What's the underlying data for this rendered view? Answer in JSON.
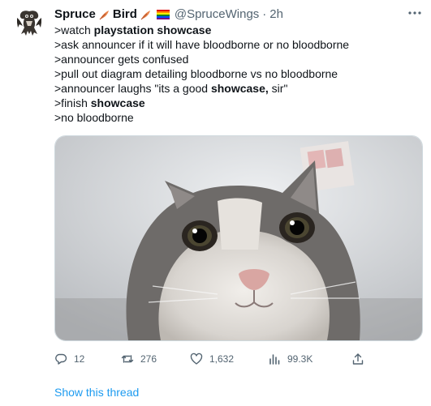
{
  "author": {
    "display_name_first": "Spruce",
    "display_name_second": "Bird",
    "handle": "@SpruceWings",
    "separator": "·",
    "time": "2h"
  },
  "icons": {
    "name_glyph_1": "feather-emoji",
    "name_glyph_2": "feather-emoji",
    "name_glyph_3": "rainbow-flag-emoji",
    "more": "more-dots-icon",
    "reply": "reply-icon",
    "retweet": "retweet-icon",
    "like": "heart-icon",
    "views": "views-icon",
    "share": "share-icon"
  },
  "body": {
    "lines": [
      {
        "pre": ">watch ",
        "bold": "playstation showcase",
        "post": ""
      },
      {
        "pre": ">ask announcer if it will have bloodborne or no bloodborne",
        "bold": "",
        "post": ""
      },
      {
        "pre": ">announcer gets confused",
        "bold": "",
        "post": ""
      },
      {
        "pre": ">pull out diagram detailing bloodborne vs no bloodborne",
        "bold": "",
        "post": ""
      },
      {
        "pre": ">announcer laughs \"its a good ",
        "bold": "showcase,",
        "post": " sir\""
      },
      {
        "pre": ">finish ",
        "bold": "showcase",
        "post": ""
      },
      {
        "pre": ">no bloodborne",
        "bold": "",
        "post": ""
      }
    ]
  },
  "stats": {
    "replies": "12",
    "retweets": "276",
    "likes": "1,632",
    "views": "99.3K"
  },
  "show_thread": "Show this thread",
  "colors": {
    "link": "#1d9bf0",
    "secondary_text": "#536471",
    "primary_text": "#0f1419",
    "border": "#cfd9de"
  }
}
